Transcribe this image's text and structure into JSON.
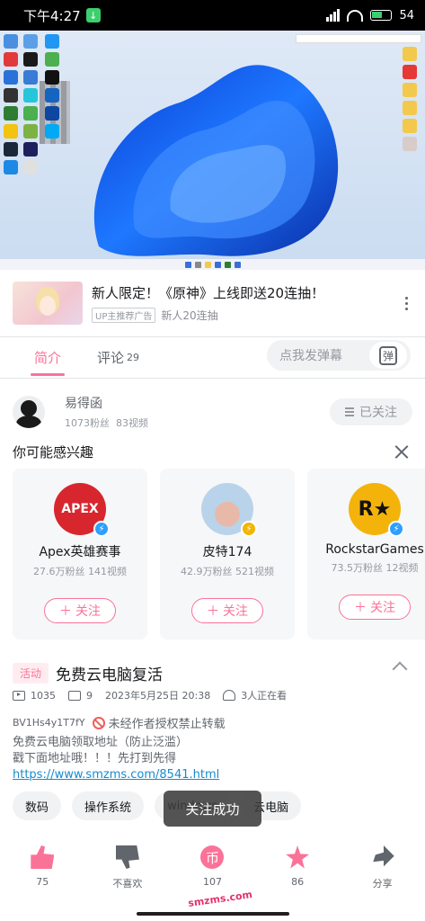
{
  "status_bar": {
    "time": "下午4:27",
    "battery": "54"
  },
  "ad": {
    "title": "新人限定！《原神》上线即送20连抽！",
    "badge": "UP主推荐广告",
    "subtitle": "新人20连抽"
  },
  "tabs": [
    {
      "label": "简介",
      "count": ""
    },
    {
      "label": "评论",
      "count": "29"
    }
  ],
  "danmu": {
    "placeholder": "点我发弹幕",
    "button": "弹"
  },
  "uploader": {
    "name": "易得函",
    "fans": "1073粉丝",
    "videos": "83视频",
    "follow_state": "已关注"
  },
  "suggestions": {
    "title": "你可能感兴趣",
    "follow_label": "关注",
    "cards": [
      {
        "name": "Apex英雄赛事",
        "fans": "27.6万粉丝",
        "videos": "141视频",
        "avatar_text": "APEX",
        "avatar_color": "#d8262f",
        "badge_color": "#2e9fff"
      },
      {
        "name": "皮特174",
        "fans": "42.9万粉丝",
        "videos": "521视频",
        "avatar_text": "",
        "avatar_color": "#b9d3ea",
        "badge_color": "#f4b400"
      },
      {
        "name": "RockstarGames",
        "fans": "73.5万粉丝",
        "videos": "12视频",
        "avatar_text": "R★",
        "avatar_color": "#f3b30a",
        "badge_color": "#2e9fff"
      }
    ]
  },
  "video_info": {
    "activity_tag": "活动",
    "title": "免费云电脑复活",
    "plays": "1035",
    "danmaku": "9",
    "date": "2023年5月25日 20:38",
    "watching": "3人正在看",
    "bvid": "BV1Hs4y1T7fY",
    "copyright": "未经作者授权禁止转载",
    "desc_lines": [
      "免费云电脑领取地址（防止泛滥）",
      "戳下面地址哦！！！先打到先得"
    ],
    "link": "https://www.smzms.com/8541.html"
  },
  "tags": [
    "数码",
    "操作系统",
    "windows",
    "云电脑"
  ],
  "toast": "关注成功",
  "actions": [
    {
      "label": "75",
      "icon": "thumbs-up-icon"
    },
    {
      "label": "不喜欢",
      "icon": "thumbs-down-icon"
    },
    {
      "label": "107",
      "icon": "coin-icon"
    },
    {
      "label": "86",
      "icon": "star-icon"
    },
    {
      "label": "分享",
      "icon": "share-icon"
    }
  ],
  "watermark": "smzms.com",
  "colors": {
    "accent": "#fb7299",
    "link": "#178bcf",
    "statusbar": "#000000"
  }
}
